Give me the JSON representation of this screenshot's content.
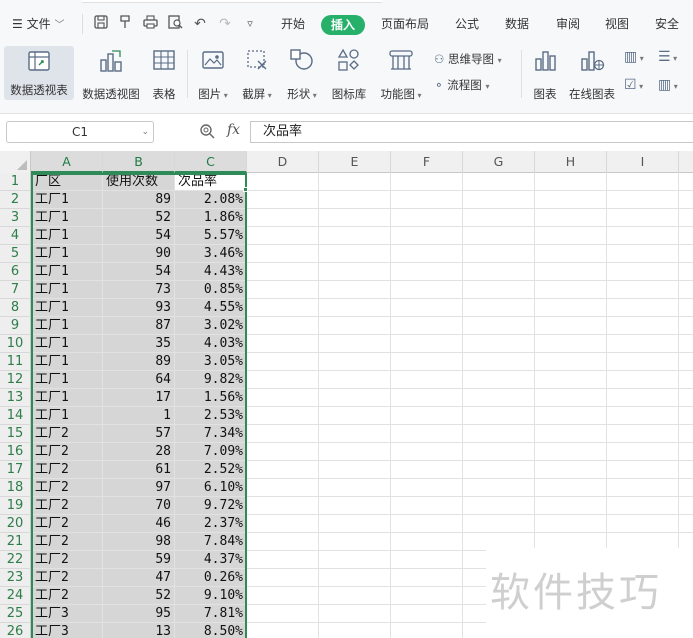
{
  "menubar": {
    "file_label": "文件",
    "tabs": [
      "开始",
      "插入",
      "页面布局",
      "公式",
      "数据",
      "审阅",
      "视图",
      "安全"
    ],
    "active_tab": "插入"
  },
  "ribbon": {
    "pivot_table": "数据透视表",
    "pivot_chart": "数据透视图",
    "table": "表格",
    "picture": "图片",
    "screenshot": "截屏",
    "shape": "形状",
    "icon_library": "图标库",
    "function_chart": "功能图",
    "mind_map": "思维导图",
    "flowchart": "流程图",
    "chart": "图表",
    "online_chart": "在线图表"
  },
  "formula_bar": {
    "cell_ref": "C1",
    "fx": "fx",
    "content": "次品率"
  },
  "grid": {
    "columns": [
      "A",
      "B",
      "C",
      "D",
      "E",
      "F",
      "G",
      "H",
      "I"
    ],
    "row_numbers": [
      "1",
      "2",
      "3",
      "4",
      "5",
      "6",
      "7",
      "8",
      "9",
      "10",
      "11",
      "12",
      "13",
      "14",
      "15",
      "16",
      "17",
      "18",
      "19",
      "20",
      "21",
      "22",
      "23",
      "24",
      "25",
      "26"
    ],
    "header": [
      "厂区",
      "使用次数",
      "次品率"
    ],
    "rows": [
      [
        "工厂1",
        "89",
        "2.08%"
      ],
      [
        "工厂1",
        "52",
        "1.86%"
      ],
      [
        "工厂1",
        "54",
        "5.57%"
      ],
      [
        "工厂1",
        "90",
        "3.46%"
      ],
      [
        "工厂1",
        "54",
        "4.43%"
      ],
      [
        "工厂1",
        "73",
        "0.85%"
      ],
      [
        "工厂1",
        "93",
        "4.55%"
      ],
      [
        "工厂1",
        "87",
        "3.02%"
      ],
      [
        "工厂1",
        "35",
        "4.03%"
      ],
      [
        "工厂1",
        "89",
        "3.05%"
      ],
      [
        "工厂1",
        "64",
        "9.82%"
      ],
      [
        "工厂1",
        "17",
        "1.56%"
      ],
      [
        "工厂1",
        "1",
        "2.53%"
      ],
      [
        "工厂2",
        "57",
        "7.34%"
      ],
      [
        "工厂2",
        "28",
        "7.09%"
      ],
      [
        "工厂2",
        "61",
        "2.52%"
      ],
      [
        "工厂2",
        "97",
        "6.10%"
      ],
      [
        "工厂2",
        "70",
        "9.72%"
      ],
      [
        "工厂2",
        "46",
        "2.37%"
      ],
      [
        "工厂2",
        "98",
        "7.84%"
      ],
      [
        "工厂2",
        "59",
        "4.37%"
      ],
      [
        "工厂2",
        "47",
        "0.26%"
      ],
      [
        "工厂2",
        "52",
        "9.10%"
      ],
      [
        "工厂3",
        "95",
        "7.81%"
      ],
      [
        "工厂3",
        "13",
        "8.50%"
      ]
    ]
  },
  "watermark": "软件技巧",
  "colors": {
    "accent": "#26b06a",
    "selection_border": "#2e8b57"
  }
}
